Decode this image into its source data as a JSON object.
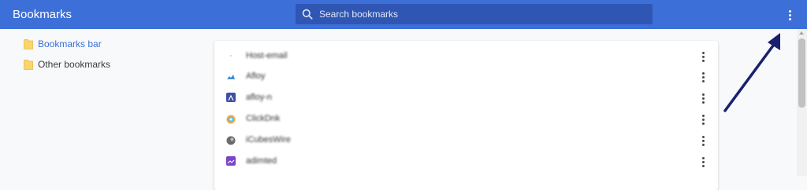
{
  "header": {
    "title": "Bookmarks",
    "search_placeholder": "Search bookmarks",
    "search_icon": "search-icon",
    "menu_icon": "more-vertical-icon",
    "background_color": "#3c6fd8"
  },
  "sidebar": {
    "items": [
      {
        "label": "Bookmarks bar",
        "icon": "folder-icon",
        "selected": true
      },
      {
        "label": "Other bookmarks",
        "icon": "folder-icon",
        "selected": false
      }
    ]
  },
  "bookmarks": {
    "items": [
      {
        "label": "Host-email",
        "favicon_color": "#e8a0a8"
      },
      {
        "label": "Afloy",
        "favicon_color": "#3a8fd8"
      },
      {
        "label": "afloy-n",
        "favicon_color": "#3d4fa3"
      },
      {
        "label": "ClickDnk",
        "favicon_color": "#f4a93c"
      },
      {
        "label": "iCubesWire",
        "favicon_color": "#6b6b6b"
      },
      {
        "label": "adimted",
        "favicon_color": "#7a45c8"
      }
    ],
    "row_menu_icon": "more-vertical-icon"
  },
  "annotation": {
    "arrow_color": "#1a1f6e"
  }
}
